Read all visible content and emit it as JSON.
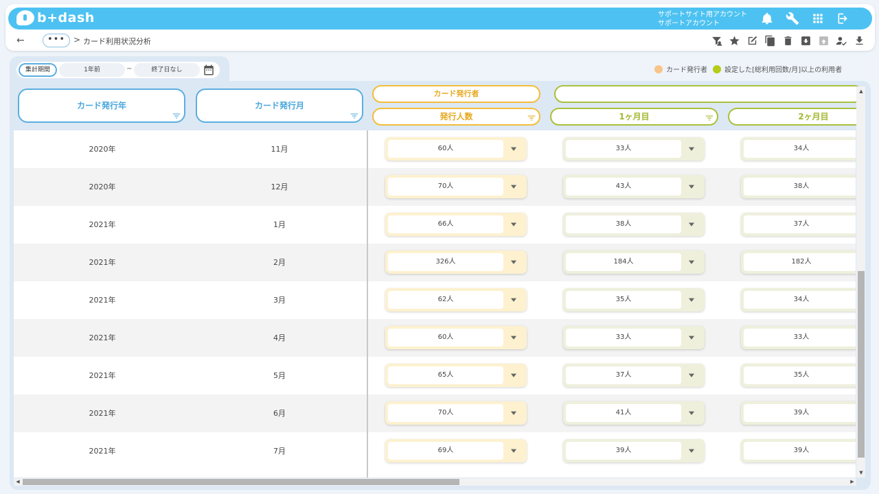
{
  "app": {
    "logo_text": "b+dash"
  },
  "account": {
    "line1": "サポートサイト用アカウント",
    "line2": "サポートアカウント"
  },
  "breadcrumb": {
    "back": "←",
    "more": "•••",
    "separator": ">",
    "current": "カード利用状況分析"
  },
  "date_filter": {
    "label": "集計期間",
    "start": "1年前",
    "tilde": "~",
    "end": "終了日なし"
  },
  "legend": [
    {
      "label": "カード発行者",
      "color": "#f9c48a"
    },
    {
      "label": "設定した[総利用回数/月]以上の利用者",
      "color": "#b5cc18"
    }
  ],
  "columns": {
    "year": "カード発行年",
    "month": "カード発行月",
    "group_issuer": "カード発行者",
    "group_users": "",
    "issued_count": "発行人数",
    "month1": "1ヶ月目",
    "month2": "2ヶ月目"
  },
  "rows": [
    {
      "year": "2020年",
      "month": "11月",
      "issued": "60人",
      "m1": "33人",
      "m2": "34人"
    },
    {
      "year": "2020年",
      "month": "12月",
      "issued": "70人",
      "m1": "43人",
      "m2": "38人"
    },
    {
      "year": "2021年",
      "month": "1月",
      "issued": "66人",
      "m1": "38人",
      "m2": "37人"
    },
    {
      "year": "2021年",
      "month": "2月",
      "issued": "326人",
      "m1": "184人",
      "m2": "182人"
    },
    {
      "year": "2021年",
      "month": "3月",
      "issued": "62人",
      "m1": "35人",
      "m2": "34人"
    },
    {
      "year": "2021年",
      "month": "4月",
      "issued": "60人",
      "m1": "33人",
      "m2": "33人"
    },
    {
      "year": "2021年",
      "month": "5月",
      "issued": "65人",
      "m1": "37人",
      "m2": "35人"
    },
    {
      "year": "2021年",
      "month": "6月",
      "issued": "70人",
      "m1": "41人",
      "m2": "39人"
    },
    {
      "year": "2021年",
      "month": "7月",
      "issued": "69人",
      "m1": "39人",
      "m2": "39人"
    }
  ],
  "colors": {
    "accent": "#4dc2f2",
    "issuer": "#f3bd3a",
    "users": "#aac03a"
  }
}
